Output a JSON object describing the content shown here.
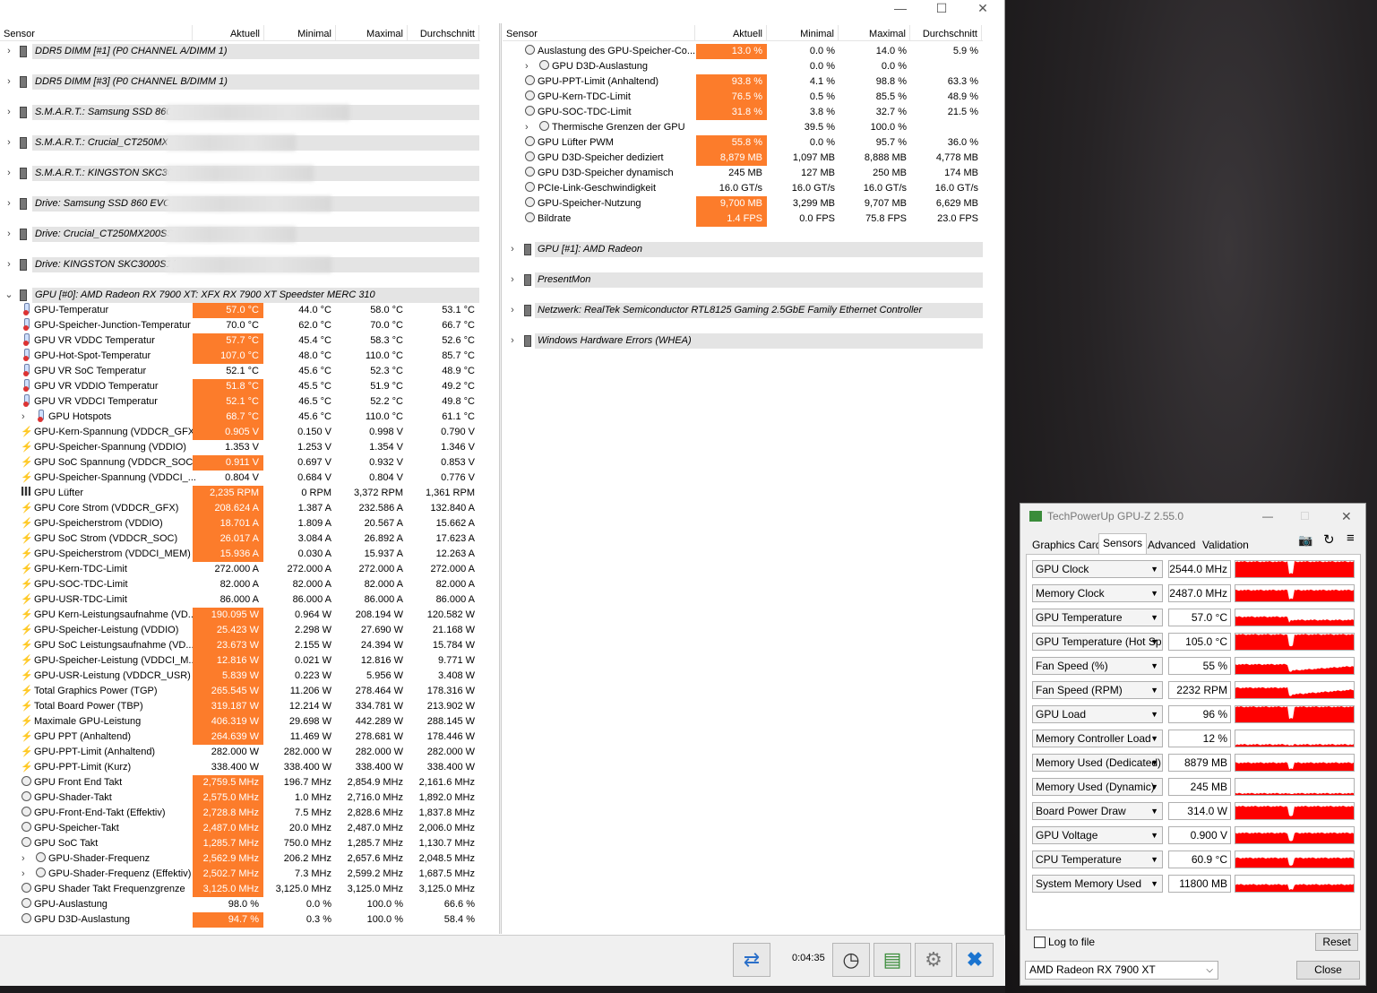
{
  "hwinfo": {
    "window_controls": {
      "minimize": "—",
      "maximize": "☐",
      "close": "✕"
    },
    "left_header": {
      "sensor": "Sensor",
      "current": "Aktuell",
      "min": "Minimal",
      "max": "Maximal",
      "avg": "Durchschnitt"
    },
    "right_header": {
      "sensor": "Sensor",
      "current": "Aktuell",
      "min": "Minimal",
      "max": "Maximal",
      "avg": "Durchschnitt"
    },
    "left_groups": [
      "DDR5 DIMM [#1] (P0 CHANNEL A/DIMM 1)",
      "DDR5 DIMM [#3] (P0 CHANNEL B/DIMM 1)",
      "S.M.A.R.T.: Samsung SSD 860",
      "S.M.A.R.T.: Crucial_CT250MX",
      "S.M.A.R.T.: KINGSTON SKC30",
      "Drive: Samsung SSD 860 EVO",
      "Drive: Crucial_CT250MX200SS",
      "Drive: KINGSTON SKC3000S1(",
      "GPU [#0]: AMD Radeon RX 7900 XT: XFX RX 7900 XT Speedster MERC 310"
    ],
    "left_rows": [
      {
        "icon": "temp",
        "name": "GPU-Temperatur",
        "cur": "57.0 °C",
        "min": "44.0 °C",
        "max": "58.0 °C",
        "avg": "53.1 °C",
        "hl": true
      },
      {
        "icon": "temp",
        "name": "GPU-Speicher-Junction-Temperatur",
        "cur": "70.0 °C",
        "min": "62.0 °C",
        "max": "70.0 °C",
        "avg": "66.7 °C",
        "hl": false
      },
      {
        "icon": "temp",
        "name": "GPU VR VDDC Temperatur",
        "cur": "57.7 °C",
        "min": "45.4 °C",
        "max": "58.3 °C",
        "avg": "52.6 °C",
        "hl": true
      },
      {
        "icon": "temp",
        "name": "GPU-Hot-Spot-Temperatur",
        "cur": "107.0 °C",
        "min": "48.0 °C",
        "max": "110.0 °C",
        "avg": "85.7 °C",
        "hl": true
      },
      {
        "icon": "temp",
        "name": "GPU VR SoC Temperatur",
        "cur": "52.1 °C",
        "min": "45.6 °C",
        "max": "52.3 °C",
        "avg": "48.9 °C",
        "hl": false
      },
      {
        "icon": "temp",
        "name": "GPU VR VDDIO Temperatur",
        "cur": "51.8 °C",
        "min": "45.5 °C",
        "max": "51.9 °C",
        "avg": "49.2 °C",
        "hl": true
      },
      {
        "icon": "temp",
        "name": "GPU VR VDDCI Temperatur",
        "cur": "52.1 °C",
        "min": "46.5 °C",
        "max": "52.2 °C",
        "avg": "49.8 °C",
        "hl": true
      },
      {
        "icon": "temp",
        "name": "GPU Hotspots",
        "cur": "68.7 °C",
        "min": "45.6 °C",
        "max": "110.0 °C",
        "avg": "61.1 °C",
        "hl": true,
        "expand": true
      },
      {
        "icon": "volt",
        "name": "GPU-Kern-Spannung (VDDCR_GFX)",
        "cur": "0.905 V",
        "min": "0.150 V",
        "max": "0.998 V",
        "avg": "0.790 V",
        "hl": true
      },
      {
        "icon": "volt",
        "name": "GPU-Speicher-Spannung (VDDIO)",
        "cur": "1.353 V",
        "min": "1.253 V",
        "max": "1.354 V",
        "avg": "1.346 V",
        "hl": false
      },
      {
        "icon": "volt",
        "name": "GPU SoC Spannung (VDDCR_SOC)",
        "cur": "0.911 V",
        "min": "0.697 V",
        "max": "0.932 V",
        "avg": "0.853 V",
        "hl": true
      },
      {
        "icon": "volt",
        "name": "GPU-Speicher-Spannung (VDDCI_...",
        "cur": "0.804 V",
        "min": "0.684 V",
        "max": "0.804 V",
        "avg": "0.776 V",
        "hl": false
      },
      {
        "icon": "fan",
        "name": "GPU Lüfter",
        "cur": "2,235 RPM",
        "min": "0 RPM",
        "max": "3,372 RPM",
        "avg": "1,361 RPM",
        "hl": true
      },
      {
        "icon": "volt",
        "name": "GPU Core Strom (VDDCR_GFX)",
        "cur": "208.624 A",
        "min": "1.387 A",
        "max": "232.586 A",
        "avg": "132.840 A",
        "hl": true
      },
      {
        "icon": "volt",
        "name": "GPU-Speicherstrom (VDDIO)",
        "cur": "18.701 A",
        "min": "1.809 A",
        "max": "20.567 A",
        "avg": "15.662 A",
        "hl": true
      },
      {
        "icon": "volt",
        "name": "GPU SoC Strom (VDDCR_SOC)",
        "cur": "26.017 A",
        "min": "3.084 A",
        "max": "26.892 A",
        "avg": "17.623 A",
        "hl": true
      },
      {
        "icon": "volt",
        "name": "GPU-Speicherstrom (VDDCI_MEM)",
        "cur": "15.936 A",
        "min": "0.030 A",
        "max": "15.937 A",
        "avg": "12.263 A",
        "hl": true
      },
      {
        "icon": "volt",
        "name": "GPU-Kern-TDC-Limit",
        "cur": "272.000 A",
        "min": "272.000 A",
        "max": "272.000 A",
        "avg": "272.000 A",
        "hl": false
      },
      {
        "icon": "volt",
        "name": "GPU-SOC-TDC-Limit",
        "cur": "82.000 A",
        "min": "82.000 A",
        "max": "82.000 A",
        "avg": "82.000 A",
        "hl": false
      },
      {
        "icon": "volt",
        "name": "GPU-USR-TDC-Limit",
        "cur": "86.000 A",
        "min": "86.000 A",
        "max": "86.000 A",
        "avg": "86.000 A",
        "hl": false
      },
      {
        "icon": "volt",
        "name": "GPU Kern-Leistungsaufnahme (VD...",
        "cur": "190.095 W",
        "min": "0.964 W",
        "max": "208.194 W",
        "avg": "120.582 W",
        "hl": true
      },
      {
        "icon": "volt",
        "name": "GPU-Speicher-Leistung (VDDIO)",
        "cur": "25.423 W",
        "min": "2.298 W",
        "max": "27.690 W",
        "avg": "21.168 W",
        "hl": true
      },
      {
        "icon": "volt",
        "name": "GPU SoC Leistungsaufnahme (VD...",
        "cur": "23.673 W",
        "min": "2.155 W",
        "max": "24.394 W",
        "avg": "15.784 W",
        "hl": true
      },
      {
        "icon": "volt",
        "name": "GPU-Speicher-Leistung (VDDCI_M...",
        "cur": "12.816 W",
        "min": "0.021 W",
        "max": "12.816 W",
        "avg": "9.771 W",
        "hl": true
      },
      {
        "icon": "volt",
        "name": "GPU-USR-Leistung (VDDCR_USR)",
        "cur": "5.839 W",
        "min": "0.223 W",
        "max": "5.956 W",
        "avg": "3.408 W",
        "hl": true
      },
      {
        "icon": "volt",
        "name": "Total Graphics Power (TGP)",
        "cur": "265.545 W",
        "min": "11.206 W",
        "max": "278.464 W",
        "avg": "178.316 W",
        "hl": true
      },
      {
        "icon": "volt",
        "name": "Total Board Power (TBP)",
        "cur": "319.187 W",
        "min": "12.214 W",
        "max": "334.781 W",
        "avg": "213.902 W",
        "hl": true
      },
      {
        "icon": "volt",
        "name": "Maximale GPU-Leistung",
        "cur": "406.319 W",
        "min": "29.698 W",
        "max": "442.289 W",
        "avg": "288.145 W",
        "hl": true
      },
      {
        "icon": "volt",
        "name": "GPU PPT (Anhaltend)",
        "cur": "264.639 W",
        "min": "11.469 W",
        "max": "278.681 W",
        "avg": "178.446 W",
        "hl": true
      },
      {
        "icon": "volt",
        "name": "GPU-PPT-Limit (Anhaltend)",
        "cur": "282.000 W",
        "min": "282.000 W",
        "max": "282.000 W",
        "avg": "282.000 W",
        "hl": false
      },
      {
        "icon": "volt",
        "name": "GPU-PPT-Limit (Kurz)",
        "cur": "338.400 W",
        "min": "338.400 W",
        "max": "338.400 W",
        "avg": "338.400 W",
        "hl": false
      },
      {
        "icon": "clk",
        "name": "GPU Front End Takt",
        "cur": "2,759.5 MHz",
        "min": "196.7 MHz",
        "max": "2,854.9 MHz",
        "avg": "2,161.6 MHz",
        "hl": true
      },
      {
        "icon": "clk",
        "name": "GPU-Shader-Takt",
        "cur": "2,575.0 MHz",
        "min": "1.0 MHz",
        "max": "2,716.0 MHz",
        "avg": "1,892.0 MHz",
        "hl": true
      },
      {
        "icon": "clk",
        "name": "GPU-Front-End-Takt (Effektiv)",
        "cur": "2,728.8 MHz",
        "min": "7.5 MHz",
        "max": "2,828.6 MHz",
        "avg": "1,837.8 MHz",
        "hl": true
      },
      {
        "icon": "clk",
        "name": "GPU-Speicher-Takt",
        "cur": "2,487.0 MHz",
        "min": "20.0 MHz",
        "max": "2,487.0 MHz",
        "avg": "2,006.0 MHz",
        "hl": true
      },
      {
        "icon": "clk",
        "name": "GPU SoC Takt",
        "cur": "1,285.7 MHz",
        "min": "750.0 MHz",
        "max": "1,285.7 MHz",
        "avg": "1,130.7 MHz",
        "hl": true
      },
      {
        "icon": "clk",
        "name": "GPU-Shader-Frequenz",
        "cur": "2,562.9 MHz",
        "min": "206.2 MHz",
        "max": "2,657.6 MHz",
        "avg": "2,048.5 MHz",
        "hl": true,
        "expand": true
      },
      {
        "icon": "clk",
        "name": "GPU-Shader-Frequenz (Effektiv)",
        "cur": "2,502.7 MHz",
        "min": "7.3 MHz",
        "max": "2,599.2 MHz",
        "avg": "1,687.5 MHz",
        "hl": true,
        "expand": true
      },
      {
        "icon": "clk",
        "name": "GPU Shader Takt Frequenzgrenze",
        "cur": "3,125.0 MHz",
        "min": "3,125.0 MHz",
        "max": "3,125.0 MHz",
        "avg": "3,125.0 MHz",
        "hl": true
      },
      {
        "icon": "clk",
        "name": "GPU-Auslastung",
        "cur": "98.0 %",
        "min": "0.0 %",
        "max": "100.0 %",
        "avg": "66.6 %",
        "hl": false
      },
      {
        "icon": "clk",
        "name": "GPU D3D-Auslastung",
        "cur": "94.7 %",
        "min": "0.3 %",
        "max": "100.0 %",
        "avg": "58.4 %",
        "hl": true
      }
    ],
    "right_rows": [
      {
        "name": "Auslastung des GPU-Speicher-Co...",
        "cur": "13.0 %",
        "min": "0.0 %",
        "max": "14.0 %",
        "avg": "5.9 %",
        "hl": true
      },
      {
        "name": "GPU D3D-Auslastung",
        "cur": "",
        "min": "0.0 %",
        "max": "0.0 %",
        "avg": "",
        "hl": false,
        "expand": true
      },
      {
        "name": "GPU-PPT-Limit (Anhaltend)",
        "cur": "93.8 %",
        "min": "4.1 %",
        "max": "98.8 %",
        "avg": "63.3 %",
        "hl": true
      },
      {
        "name": "GPU-Kern-TDC-Limit",
        "cur": "76.5 %",
        "min": "0.5 %",
        "max": "85.5 %",
        "avg": "48.9 %",
        "hl": true
      },
      {
        "name": "GPU-SOC-TDC-Limit",
        "cur": "31.8 %",
        "min": "3.8 %",
        "max": "32.7 %",
        "avg": "21.5 %",
        "hl": true
      },
      {
        "name": "Thermische Grenzen der GPU",
        "cur": "",
        "min": "39.5 %",
        "max": "100.0 %",
        "avg": "",
        "hl": false,
        "expand": true
      },
      {
        "name": "GPU Lüfter PWM",
        "cur": "55.8 %",
        "min": "0.0 %",
        "max": "95.7 %",
        "avg": "36.0 %",
        "hl": true
      },
      {
        "name": "GPU D3D-Speicher dediziert",
        "cur": "8,879 MB",
        "min": "1,097 MB",
        "max": "8,888 MB",
        "avg": "4,778 MB",
        "hl": true
      },
      {
        "name": "GPU D3D-Speicher dynamisch",
        "cur": "245 MB",
        "min": "127 MB",
        "max": "250 MB",
        "avg": "174 MB",
        "hl": false
      },
      {
        "name": "PCIe-Link-Geschwindigkeit",
        "cur": "16.0 GT/s",
        "min": "16.0 GT/s",
        "max": "16.0 GT/s",
        "avg": "16.0 GT/s",
        "hl": false
      },
      {
        "name": "GPU-Speicher-Nutzung",
        "cur": "9,700 MB",
        "min": "3,299 MB",
        "max": "9,707 MB",
        "avg": "6,629 MB",
        "hl": true
      },
      {
        "name": "Bildrate",
        "cur": "1.4 FPS",
        "min": "0.0 FPS",
        "max": "75.8 FPS",
        "avg": "23.0 FPS",
        "hl": true
      }
    ],
    "right_groups": [
      "GPU [#1]: AMD Radeon",
      "PresentMon",
      "Netzwerk: RealTek Semiconductor RTL8125 Gaming 2.5GbE Family Ethernet Controller",
      "Windows Hardware Errors (WHEA)"
    ],
    "status": {
      "timer": "0:04:35"
    }
  },
  "gpuz": {
    "title": "TechPowerUp GPU-Z 2.55.0",
    "tabs": [
      "Graphics Card",
      "Sensors",
      "Advanced",
      "Validation"
    ],
    "active_tab": "Sensors",
    "sensors": [
      {
        "name": "GPU Clock",
        "value": "2544.0 MHz",
        "level": 0.92
      },
      {
        "name": "Memory Clock",
        "value": "2487.0 MHz",
        "level": 0.65
      },
      {
        "name": "GPU Temperature",
        "value": "57.0 °C",
        "level": 0.5
      },
      {
        "name": "GPU Temperature (Hot Spot)",
        "value": "105.0 °C",
        "level": 0.9
      },
      {
        "name": "Fan Speed (%)",
        "value": "55 %",
        "level": 0.55
      },
      {
        "name": "Fan Speed (RPM)",
        "value": "2232 RPM",
        "level": 0.6
      },
      {
        "name": "GPU Load",
        "value": "96 %",
        "level": 0.92
      },
      {
        "name": "Memory Controller Load",
        "value": "12 %",
        "level": 0.08
      },
      {
        "name": "Memory Used (Dedicated)",
        "value": "8879 MB",
        "level": 0.45
      },
      {
        "name": "Memory Used (Dynamic)",
        "value": "245 MB",
        "level": 0.05
      },
      {
        "name": "Board Power Draw",
        "value": "314.0 W",
        "level": 0.75
      },
      {
        "name": "GPU Voltage",
        "value": "0.900 V",
        "level": 0.6
      },
      {
        "name": "CPU Temperature",
        "value": "60.9 °C",
        "level": 0.55
      },
      {
        "name": "System Memory Used",
        "value": "11800 MB",
        "level": 0.4
      }
    ],
    "log_to_file": "Log to file",
    "reset": "Reset",
    "device": "AMD Radeon RX 7900 XT",
    "close": "Close",
    "accent": "#ff0000"
  }
}
